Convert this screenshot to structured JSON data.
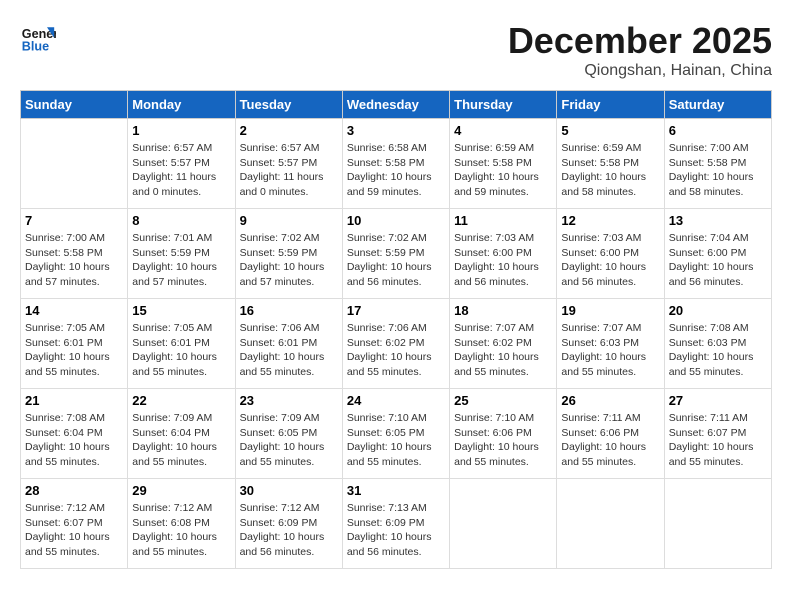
{
  "header": {
    "logo_line1": "General",
    "logo_line2": "Blue",
    "month": "December 2025",
    "location": "Qiongshan, Hainan, China"
  },
  "days_of_week": [
    "Sunday",
    "Monday",
    "Tuesday",
    "Wednesday",
    "Thursday",
    "Friday",
    "Saturday"
  ],
  "weeks": [
    [
      {
        "day": "",
        "info": ""
      },
      {
        "day": "1",
        "info": "Sunrise: 6:57 AM\nSunset: 5:57 PM\nDaylight: 11 hours\nand 0 minutes."
      },
      {
        "day": "2",
        "info": "Sunrise: 6:57 AM\nSunset: 5:57 PM\nDaylight: 11 hours\nand 0 minutes."
      },
      {
        "day": "3",
        "info": "Sunrise: 6:58 AM\nSunset: 5:58 PM\nDaylight: 10 hours\nand 59 minutes."
      },
      {
        "day": "4",
        "info": "Sunrise: 6:59 AM\nSunset: 5:58 PM\nDaylight: 10 hours\nand 59 minutes."
      },
      {
        "day": "5",
        "info": "Sunrise: 6:59 AM\nSunset: 5:58 PM\nDaylight: 10 hours\nand 58 minutes."
      },
      {
        "day": "6",
        "info": "Sunrise: 7:00 AM\nSunset: 5:58 PM\nDaylight: 10 hours\nand 58 minutes."
      }
    ],
    [
      {
        "day": "7",
        "info": "Sunrise: 7:00 AM\nSunset: 5:58 PM\nDaylight: 10 hours\nand 57 minutes."
      },
      {
        "day": "8",
        "info": "Sunrise: 7:01 AM\nSunset: 5:59 PM\nDaylight: 10 hours\nand 57 minutes."
      },
      {
        "day": "9",
        "info": "Sunrise: 7:02 AM\nSunset: 5:59 PM\nDaylight: 10 hours\nand 57 minutes."
      },
      {
        "day": "10",
        "info": "Sunrise: 7:02 AM\nSunset: 5:59 PM\nDaylight: 10 hours\nand 56 minutes."
      },
      {
        "day": "11",
        "info": "Sunrise: 7:03 AM\nSunset: 6:00 PM\nDaylight: 10 hours\nand 56 minutes."
      },
      {
        "day": "12",
        "info": "Sunrise: 7:03 AM\nSunset: 6:00 PM\nDaylight: 10 hours\nand 56 minutes."
      },
      {
        "day": "13",
        "info": "Sunrise: 7:04 AM\nSunset: 6:00 PM\nDaylight: 10 hours\nand 56 minutes."
      }
    ],
    [
      {
        "day": "14",
        "info": "Sunrise: 7:05 AM\nSunset: 6:01 PM\nDaylight: 10 hours\nand 55 minutes."
      },
      {
        "day": "15",
        "info": "Sunrise: 7:05 AM\nSunset: 6:01 PM\nDaylight: 10 hours\nand 55 minutes."
      },
      {
        "day": "16",
        "info": "Sunrise: 7:06 AM\nSunset: 6:01 PM\nDaylight: 10 hours\nand 55 minutes."
      },
      {
        "day": "17",
        "info": "Sunrise: 7:06 AM\nSunset: 6:02 PM\nDaylight: 10 hours\nand 55 minutes."
      },
      {
        "day": "18",
        "info": "Sunrise: 7:07 AM\nSunset: 6:02 PM\nDaylight: 10 hours\nand 55 minutes."
      },
      {
        "day": "19",
        "info": "Sunrise: 7:07 AM\nSunset: 6:03 PM\nDaylight: 10 hours\nand 55 minutes."
      },
      {
        "day": "20",
        "info": "Sunrise: 7:08 AM\nSunset: 6:03 PM\nDaylight: 10 hours\nand 55 minutes."
      }
    ],
    [
      {
        "day": "21",
        "info": "Sunrise: 7:08 AM\nSunset: 6:04 PM\nDaylight: 10 hours\nand 55 minutes."
      },
      {
        "day": "22",
        "info": "Sunrise: 7:09 AM\nSunset: 6:04 PM\nDaylight: 10 hours\nand 55 minutes."
      },
      {
        "day": "23",
        "info": "Sunrise: 7:09 AM\nSunset: 6:05 PM\nDaylight: 10 hours\nand 55 minutes."
      },
      {
        "day": "24",
        "info": "Sunrise: 7:10 AM\nSunset: 6:05 PM\nDaylight: 10 hours\nand 55 minutes."
      },
      {
        "day": "25",
        "info": "Sunrise: 7:10 AM\nSunset: 6:06 PM\nDaylight: 10 hours\nand 55 minutes."
      },
      {
        "day": "26",
        "info": "Sunrise: 7:11 AM\nSunset: 6:06 PM\nDaylight: 10 hours\nand 55 minutes."
      },
      {
        "day": "27",
        "info": "Sunrise: 7:11 AM\nSunset: 6:07 PM\nDaylight: 10 hours\nand 55 minutes."
      }
    ],
    [
      {
        "day": "28",
        "info": "Sunrise: 7:12 AM\nSunset: 6:07 PM\nDaylight: 10 hours\nand 55 minutes."
      },
      {
        "day": "29",
        "info": "Sunrise: 7:12 AM\nSunset: 6:08 PM\nDaylight: 10 hours\nand 55 minutes."
      },
      {
        "day": "30",
        "info": "Sunrise: 7:12 AM\nSunset: 6:09 PM\nDaylight: 10 hours\nand 56 minutes."
      },
      {
        "day": "31",
        "info": "Sunrise: 7:13 AM\nSunset: 6:09 PM\nDaylight: 10 hours\nand 56 minutes."
      },
      {
        "day": "",
        "info": ""
      },
      {
        "day": "",
        "info": ""
      },
      {
        "day": "",
        "info": ""
      }
    ]
  ]
}
